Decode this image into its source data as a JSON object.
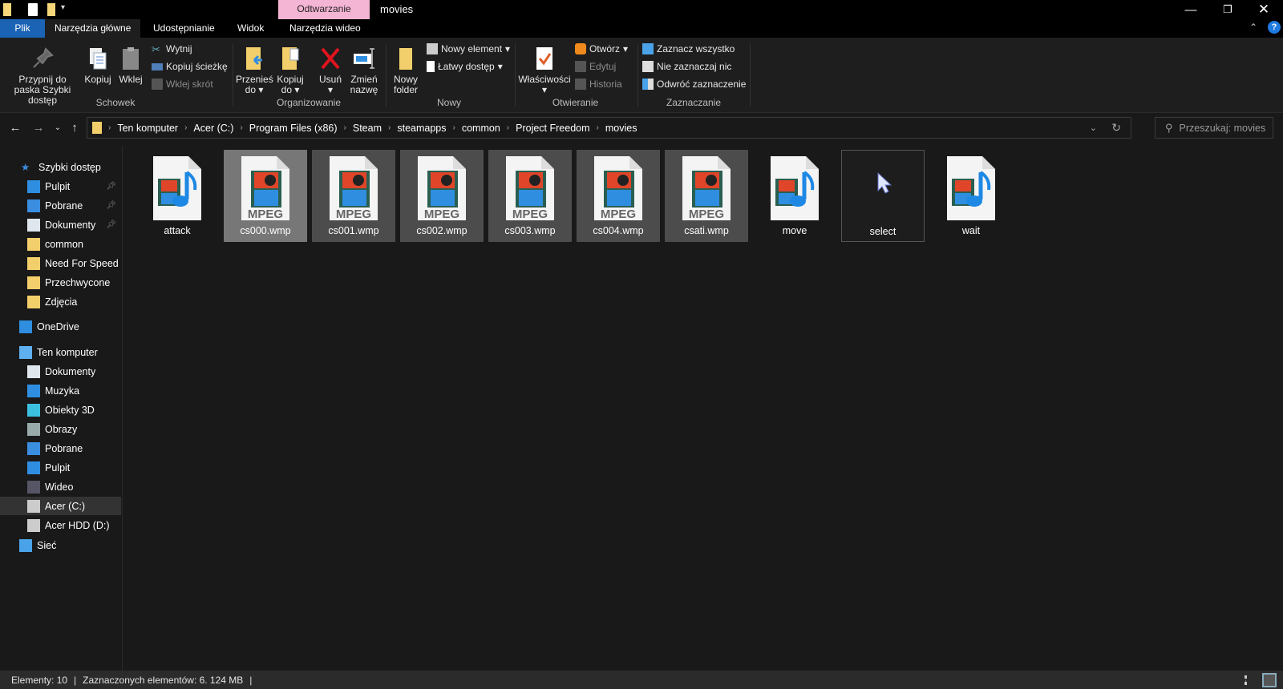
{
  "window": {
    "title": "movies",
    "context_tab": "Odtwarzanie"
  },
  "tabs": [
    {
      "label": "Plik"
    },
    {
      "label": "Narzędzia główne"
    },
    {
      "label": "Udostępnianie"
    },
    {
      "label": "Widok"
    },
    {
      "label": "Narzędzia wideo"
    }
  ],
  "ribbon": {
    "schowek": {
      "group": "Schowek",
      "pin": "Przypnij do paska Szybki dostęp",
      "copy": "Kopiuj",
      "paste": "Wklej",
      "cut": "Wytnij",
      "copy_path": "Kopiuj ścieżkę",
      "paste_shortcut": "Wklej skrót"
    },
    "organizowanie": {
      "group": "Organizowanie",
      "move_to": "Przenieś do",
      "copy_to": "Kopiuj do",
      "delete": "Usuń",
      "rename": "Zmień nazwę"
    },
    "nowy": {
      "group": "Nowy",
      "new_folder": "Nowy folder",
      "new_item": "Nowy element",
      "easy_access": "Łatwy dostęp"
    },
    "otwieranie": {
      "group": "Otwieranie",
      "properties": "Właściwości",
      "open": "Otwórz",
      "edit": "Edytuj",
      "history": "Historia"
    },
    "zaznaczanie": {
      "group": "Zaznaczanie",
      "select_all": "Zaznacz wszystko",
      "select_none": "Nie zaznaczaj nic",
      "invert": "Odwróć zaznaczenie"
    }
  },
  "breadcrumb": [
    "Ten komputer",
    "Acer (C:)",
    "Program Files (x86)",
    "Steam",
    "steamapps",
    "common",
    "Project Freedom",
    "movies"
  ],
  "search": {
    "placeholder": "Przeszukaj: movies"
  },
  "sidebar": {
    "quick_access": "Szybki dostęp",
    "quick_items": [
      {
        "label": "Pulpit",
        "icon": "desktop-icon",
        "pinned": true
      },
      {
        "label": "Pobrane",
        "icon": "download-icon",
        "pinned": true
      },
      {
        "label": "Dokumenty",
        "icon": "document-icon",
        "pinned": true
      },
      {
        "label": "common",
        "icon": "folder-icon"
      },
      {
        "label": "Need For Speed - Most Wanted",
        "icon": "folder-icon"
      },
      {
        "label": "Przechwycone",
        "icon": "folder-icon"
      },
      {
        "label": "Zdjęcia",
        "icon": "folder-icon"
      }
    ],
    "onedrive": "OneDrive",
    "this_pc": "Ten komputer",
    "pc_items": [
      {
        "label": "Dokumenty",
        "icon": "document-icon"
      },
      {
        "label": "Muzyka",
        "icon": "music-icon"
      },
      {
        "label": "Obiekty 3D",
        "icon": "cube-icon"
      },
      {
        "label": "Obrazy",
        "icon": "pictures-icon"
      },
      {
        "label": "Pobrane",
        "icon": "download-icon"
      },
      {
        "label": "Pulpit",
        "icon": "desktop-icon"
      },
      {
        "label": "Wideo",
        "icon": "video-icon"
      },
      {
        "label": "Acer (C:)",
        "icon": "drive-c-icon",
        "selected": true
      },
      {
        "label": "Acer HDD (D:)",
        "icon": "drive-icon"
      }
    ],
    "network": "Sieć"
  },
  "files": [
    {
      "name": "attack",
      "type": "audio",
      "state": "normal"
    },
    {
      "name": "cs000.wmp",
      "type": "mpeg",
      "state": "hover"
    },
    {
      "name": "cs001.wmp",
      "type": "mpeg",
      "state": "selected"
    },
    {
      "name": "cs002.wmp",
      "type": "mpeg",
      "state": "selected"
    },
    {
      "name": "cs003.wmp",
      "type": "mpeg",
      "state": "selected"
    },
    {
      "name": "cs004.wmp",
      "type": "mpeg",
      "state": "selected"
    },
    {
      "name": "csati.wmp",
      "type": "mpeg",
      "state": "selected"
    },
    {
      "name": "move",
      "type": "audio",
      "state": "normal"
    },
    {
      "name": "select",
      "type": "cursor",
      "state": "focused"
    },
    {
      "name": "wait",
      "type": "audio",
      "state": "normal"
    }
  ],
  "mpeg_label": "MPEG",
  "status": {
    "count": "Elementy: 10",
    "selected": "Zaznaczonych elementów: 6. 124 MB"
  }
}
